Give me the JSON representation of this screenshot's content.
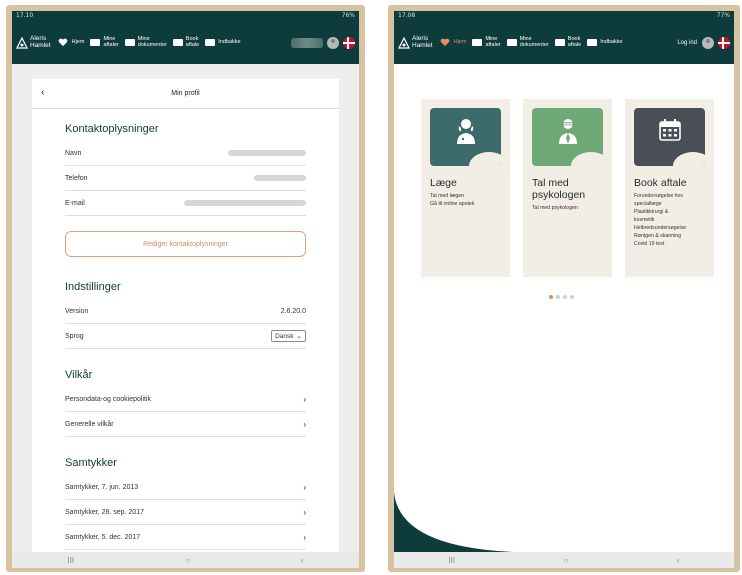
{
  "left": {
    "status_time": "17.10",
    "status_right": "76%",
    "logo": {
      "line1": "Aleris",
      "line2": "Hamlet"
    },
    "nav": [
      {
        "label": "Hjem"
      },
      {
        "label": "Mine\naftaler"
      },
      {
        "label": "Mine\ndokumenter"
      },
      {
        "label": "Book\naftale"
      },
      {
        "label": "Indbakke"
      }
    ],
    "profile": {
      "title": "Min profil",
      "contact_title": "Kontaktoplysninger",
      "contact_rows": [
        {
          "label": "Navn"
        },
        {
          "label": "Telefon"
        },
        {
          "label": "E-mail"
        }
      ],
      "edit_button": "Rediger kontaktoplysninger",
      "settings_title": "Indstillinger",
      "version_label": "Version",
      "version_value": "2.6.20.0",
      "language_label": "Sprog",
      "language_value": "Dansk",
      "terms_title": "Vilkår",
      "terms_items": [
        {
          "label": "Persondata-og cookiepolitik"
        },
        {
          "label": "Generelle vilkår"
        }
      ],
      "consent_title": "Samtykker",
      "consent_items": [
        {
          "label": "Samtykker, 7. jun. 2013"
        },
        {
          "label": "Samtykker, 28. sep. 2017"
        },
        {
          "label": "Samtykker, 5. dec. 2017"
        }
      ]
    }
  },
  "right": {
    "status_time": "17.08",
    "status_right": "77%",
    "logo": {
      "line1": "Aleris",
      "line2": "Hamlet"
    },
    "nav": [
      {
        "label": "Hjem"
      },
      {
        "label": "Mine\naftaler"
      },
      {
        "label": "Mine\ndokumenter"
      },
      {
        "label": "Book\naftale"
      },
      {
        "label": "Indbakke"
      }
    ],
    "login_label": "Log ind",
    "tiles": [
      {
        "title": "Læge",
        "sub": "Tal med lægen\nGå til online apotek",
        "icon": "female-doctor-icon",
        "color": "#3d6a6b"
      },
      {
        "title": "Tal med\npsykologen",
        "sub": "Tal med psykologen",
        "icon": "male-psychologist-icon",
        "color": "#6ea877"
      },
      {
        "title": "Book aftale",
        "sub": "Forundersøgelse hos\nspeciallæge\nPlastikkirurgi &\nkosmetik\nHelbredsundersøgelse\nRøntgen & skanning\nCovid 19 test",
        "icon": "calendar-icon",
        "color": "#4a4e57"
      }
    ],
    "carousel_pages": 4,
    "carousel_active": 1
  },
  "colors": {
    "brand": "#0e3b3c",
    "accent": "#e4905f"
  },
  "system_nav": {
    "recent": "III",
    "home": "○",
    "back": "‹"
  }
}
